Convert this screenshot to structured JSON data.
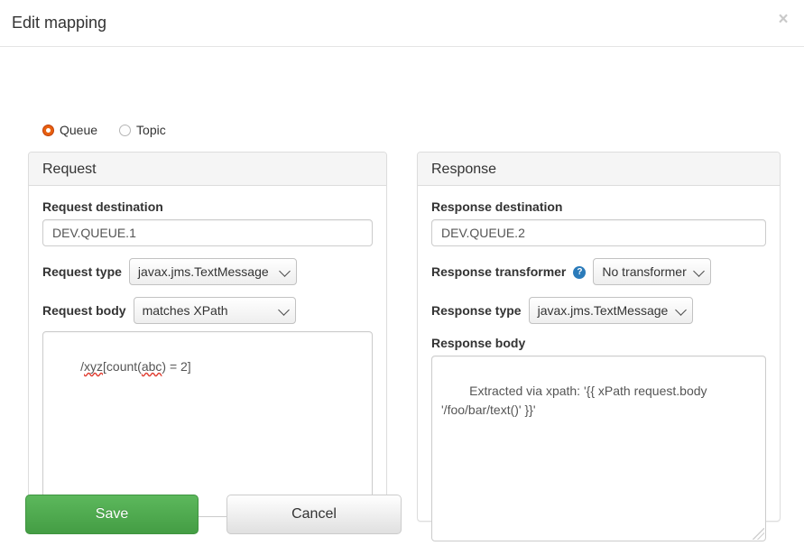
{
  "modal": {
    "title": "Edit mapping",
    "close_label": "×"
  },
  "destination_kind": {
    "options": [
      {
        "label": "Queue",
        "selected": true
      },
      {
        "label": "Topic",
        "selected": false
      }
    ],
    "queue_label": "Queue",
    "topic_label": "Topic"
  },
  "request": {
    "panel_title": "Request",
    "destination_label": "Request destination",
    "destination_value": "DEV.QUEUE.1",
    "destination_placeholder": "",
    "type_label": "Request type",
    "type_value": "javax.jms.TextMessage",
    "body_label": "Request body",
    "body_match_value": "matches XPath",
    "body_value": "/xyz[count(abc) = 2]",
    "body_tokens": {
      "prefix": "/",
      "misspelled_1": "xyz",
      "middle": "[count(",
      "misspelled_2": "abc",
      "suffix": ") = 2]"
    }
  },
  "response": {
    "panel_title": "Response",
    "destination_label": "Response destination",
    "destination_value": "DEV.QUEUE.2",
    "destination_placeholder": "",
    "transformer_label": "Response transformer",
    "transformer_help_glyph": "?",
    "transformer_value": "No transformer",
    "type_label": "Response type",
    "type_value": "javax.jms.TextMessage",
    "body_label": "Response body",
    "body_value": "Extracted via xpath: '{{ xPath request.body '/foo/bar/text()' }}'"
  },
  "footer": {
    "save_label": "Save",
    "cancel_label": "Cancel"
  },
  "colors": {
    "accent_radio": "#e8600f",
    "save_green": "#5cb85c",
    "help_blue": "#2b7bba",
    "panel_border": "#dddddd",
    "panel_heading_bg": "#f5f5f5",
    "spell_underline": "#e03b2f"
  }
}
